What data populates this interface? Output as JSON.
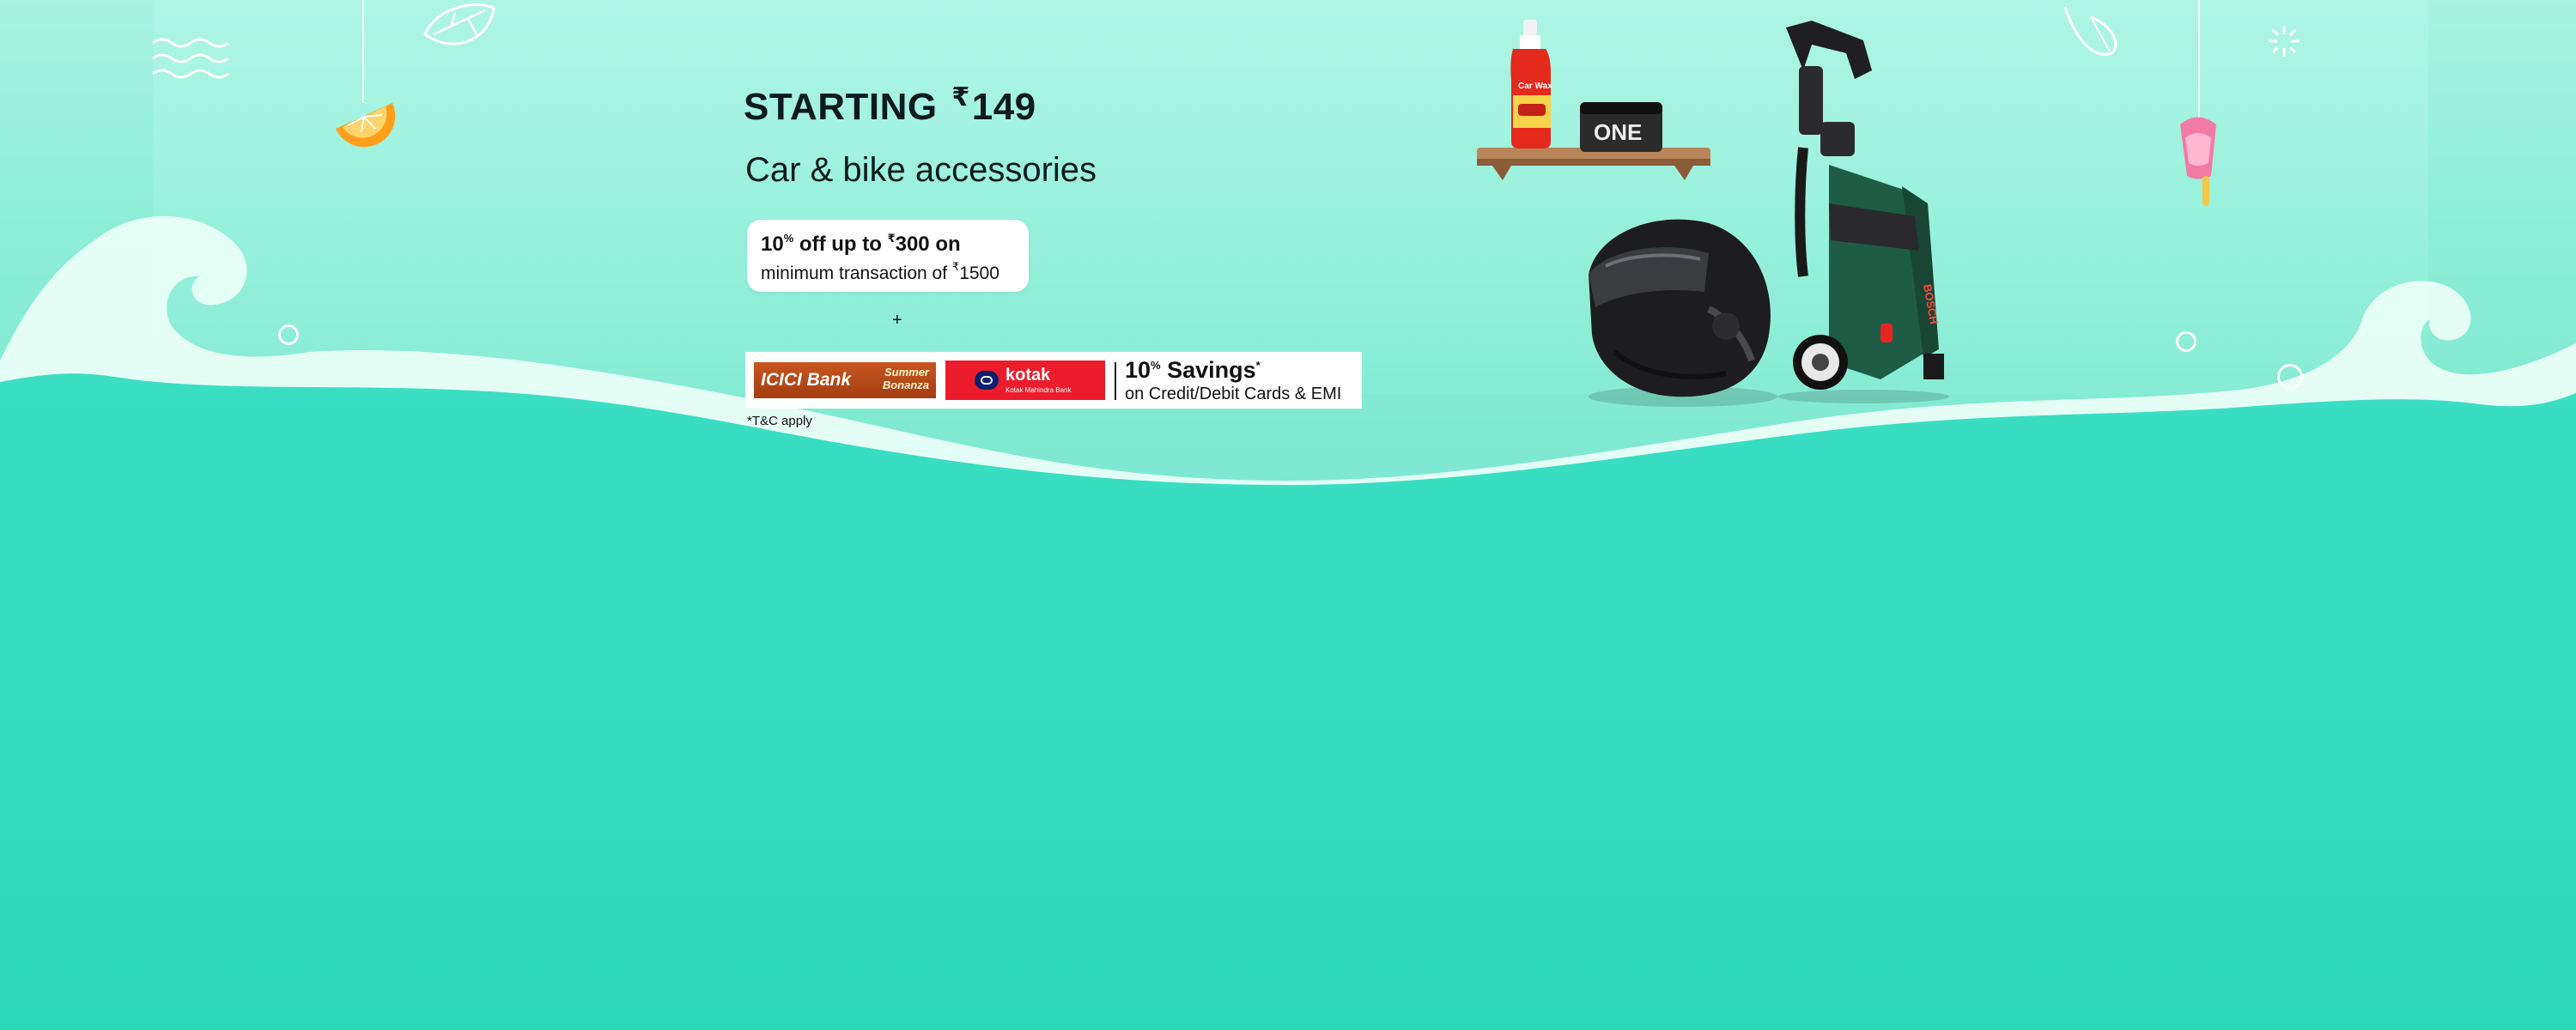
{
  "banner": {
    "headline_prefix": "STARTING",
    "currency_symbol": "₹",
    "headline_amount": "149",
    "subheading": "Car & bike accessories",
    "offer": {
      "percent": "10",
      "percent_sign": "%",
      "line1_mid": " off up to ",
      "currency_symbol": "₹",
      "cap_amount": "300",
      "line1_suffix": " on",
      "line2_prefix": "minimum transaction of ",
      "line2_currency": "₹",
      "line2_amount": "1500"
    },
    "plus": "+",
    "banks": {
      "icici_label": "ICICI Bank",
      "icici_bonanza": "Summer Bonanza",
      "kotak_label": "kotak",
      "kotak_sub": "Kotak Mahindra Bank",
      "savings_percent": "10",
      "savings_percent_sign": "%",
      "savings_word": " Savings",
      "savings_asterisk": "*",
      "savings_sub": "on Credit/Debit Cards & EMI"
    },
    "tnc": "*T&C apply",
    "product_text": {
      "bottle_label": "Car Wax",
      "can_label": "ONE",
      "washer_brand": "BOSCH"
    },
    "colors": {
      "sea": "#2fdcbd",
      "sky": "#8ceed5",
      "icici": "#b0471a",
      "kotak": "#ec1c2c",
      "washer_green": "#1f5c45"
    },
    "icons": [
      "orange-slice-icon",
      "wave-lines-icon",
      "leaf-icon",
      "ice-cream-cone-icon",
      "popsicle-icon",
      "sparkle-icon",
      "ring-bubble-icon"
    ]
  }
}
